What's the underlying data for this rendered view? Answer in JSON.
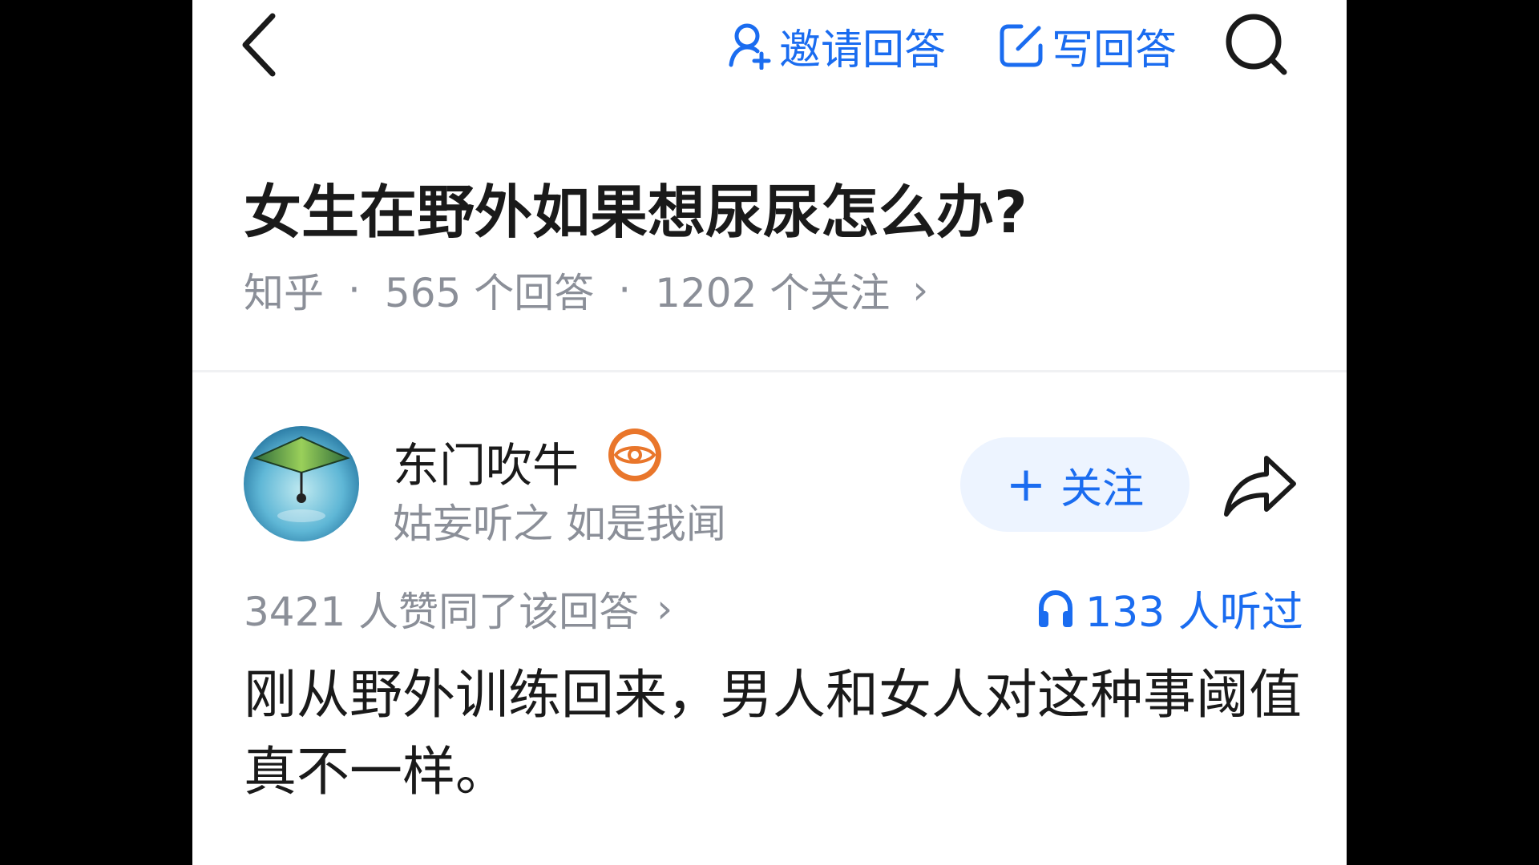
{
  "colors": {
    "accent": "#1a6cf0",
    "text_primary": "#1a1a1a",
    "text_secondary": "#8b8f98",
    "follow_bg": "#edf4ff"
  },
  "topbar": {
    "back_icon": "chevron-left-icon",
    "invite_label": "邀请回答",
    "invite_icon": "person-add-icon",
    "write_label": "写回答",
    "write_icon": "edit-icon",
    "search_icon": "search-icon"
  },
  "question": {
    "title": "女生在野外如果想尿尿怎么办?",
    "source": "知乎",
    "separator": "·",
    "answers": "565 个回答",
    "followers": "1202 个关注",
    "chevron": "›"
  },
  "author": {
    "name": "东门吹牛",
    "badge_icon": "eye-badge-icon",
    "bio": "姑妄听之 如是我闻",
    "follow_label": "关注",
    "follow_plus": "+",
    "share_icon": "share-icon"
  },
  "answer": {
    "votes": "3421 人赞同了该回答",
    "votes_chevron": "›",
    "listen_icon": "headphones-icon",
    "listen_count": "133 人听过",
    "text": "刚从野外训练回来，男人和女人对这种事阈值真不一样。"
  }
}
